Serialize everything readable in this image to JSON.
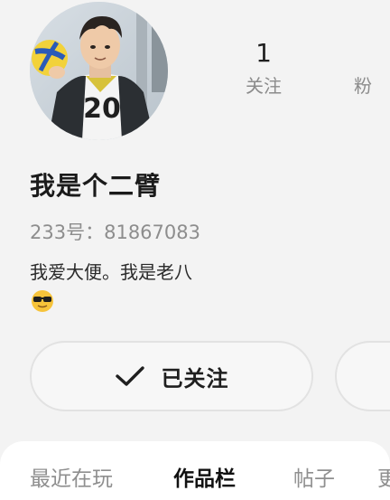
{
  "profile": {
    "username": "我是个二臂",
    "id_label": "233号：",
    "id_value": "81867083",
    "bio": "我爱大便。我是老八",
    "avatar_jersey_number": "20"
  },
  "stats": {
    "following_count": "1",
    "following_label": "关注",
    "fans_label": "粉"
  },
  "actions": {
    "follow_label": "已关注"
  },
  "tabs": [
    {
      "label": "最近在玩",
      "active": false
    },
    {
      "label": "作品栏",
      "active": true
    },
    {
      "label": "帖子",
      "active": false
    },
    {
      "label": "更",
      "active": false
    }
  ],
  "colors": {
    "background": "#f3f3f3",
    "muted_text": "#8d8d8d",
    "primary_text": "#1f1f1f",
    "button_border": "#e2e2e2"
  }
}
